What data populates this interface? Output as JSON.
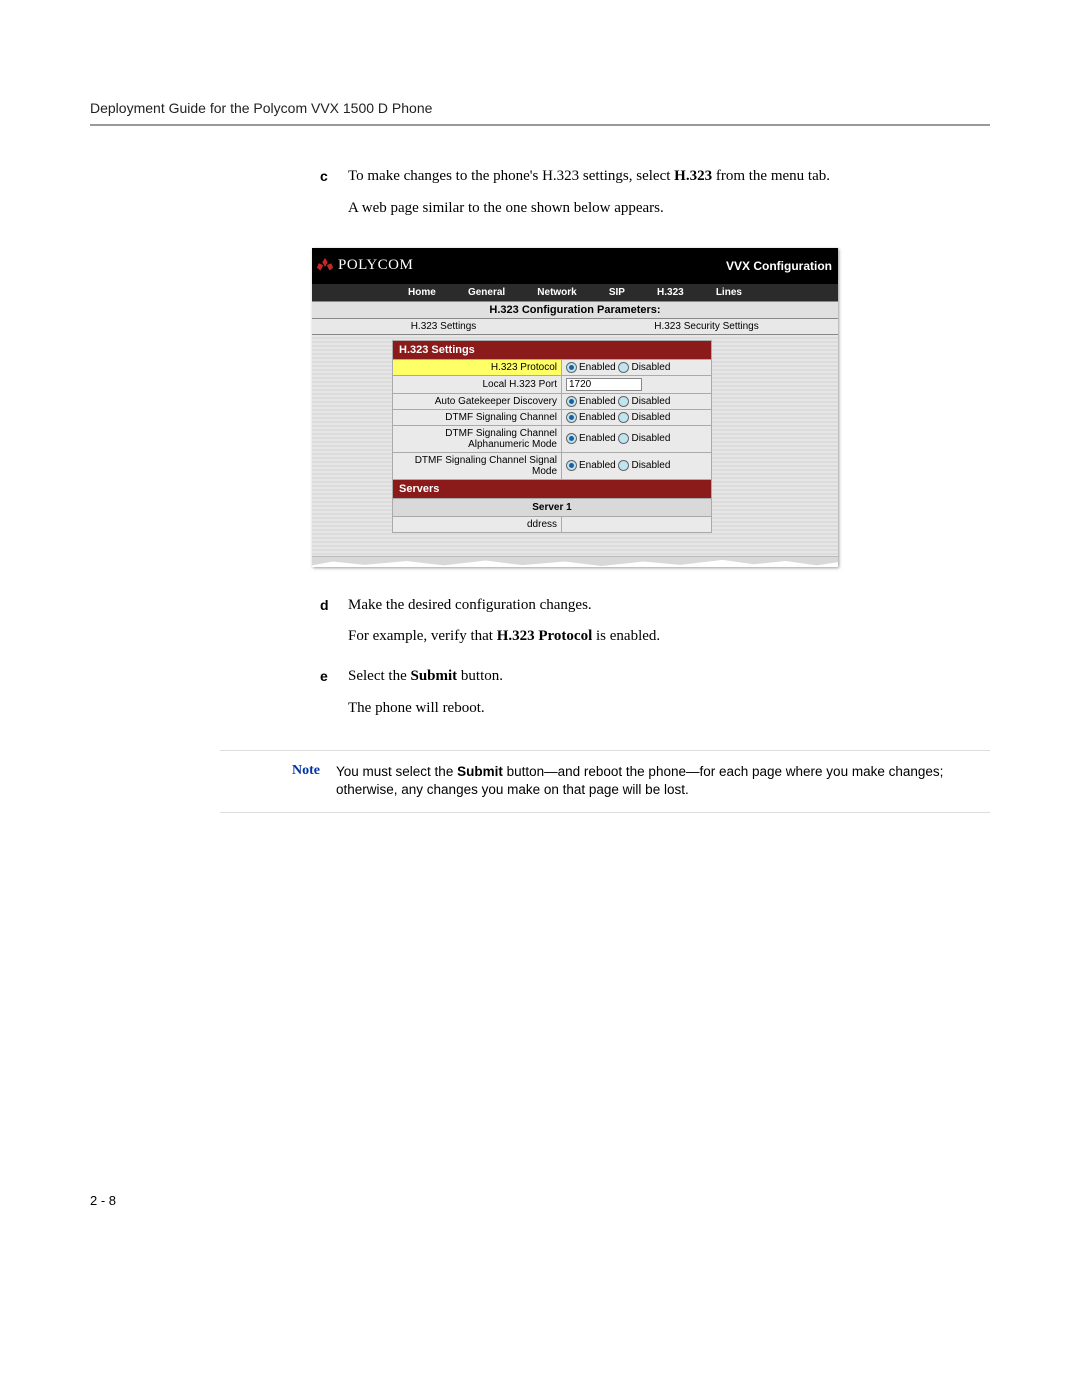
{
  "header": {
    "title": "Deployment Guide for the Polycom VVX 1500 D Phone"
  },
  "steps": {
    "c": {
      "letter": "c",
      "p1a": "To make changes to the phone's H.323 settings, select ",
      "p1b": "H.323",
      "p1c": " from the menu tab.",
      "p2": "A web page similar to the one shown below appears."
    },
    "d": {
      "letter": "d",
      "p1": "Make the desired configuration changes.",
      "p2a": "For example, verify that ",
      "p2b": "H.323 Protocol",
      "p2c": " is enabled."
    },
    "e": {
      "letter": "e",
      "p1a": "Select the ",
      "p1b": "Submit",
      "p1c": " button.",
      "p2": "The phone will reboot."
    }
  },
  "screenshot": {
    "logo_text": "POLYCOM",
    "title_right": "VVX Configuration",
    "menu": [
      "Home",
      "General",
      "Network",
      "SIP",
      "H.323",
      "Lines"
    ],
    "params_title": "H.323 Configuration Parameters:",
    "subtabs": [
      "H.323 Settings",
      "H.323 Security Settings"
    ],
    "section_settings": "H.323 Settings",
    "rows": [
      {
        "label": "H.323 Protocol",
        "type": "radio",
        "sel": "Enabled",
        "highlight": true
      },
      {
        "label": "Local H.323 Port",
        "type": "text",
        "value": "1720"
      },
      {
        "label": "Auto Gatekeeper Discovery",
        "type": "radio",
        "sel": "Enabled"
      },
      {
        "label": "DTMF Signaling Channel",
        "type": "radio",
        "sel": "Enabled"
      },
      {
        "label": "DTMF Signaling Channel Alphanumeric Mode",
        "type": "radio",
        "sel": "Enabled"
      },
      {
        "label": "DTMF Signaling Channel Signal Mode",
        "type": "radio",
        "sel": "Enabled"
      }
    ],
    "radio_options": [
      "Enabled",
      "Disabled"
    ],
    "section_servers": "Servers",
    "server_title": "Server 1",
    "cutoff_label": "ddress"
  },
  "note": {
    "label": "Note",
    "text_a": "You must select the ",
    "text_b": "Submit",
    "text_c": " button—and reboot the phone—for each page where you make changes; otherwise, any changes you make on that page will be lost."
  },
  "footer": {
    "page": "2 - 8"
  }
}
